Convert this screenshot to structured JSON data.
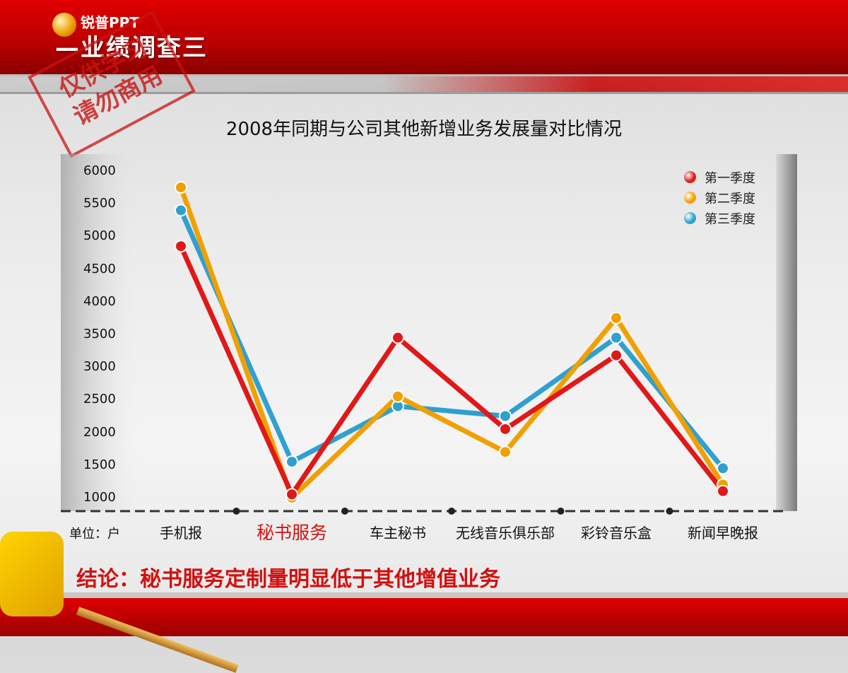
{
  "header": {
    "title": "—业绩调查三",
    "logo_text": "锐普PPT",
    "stamp_text": "仅供学习 请勿商用"
  },
  "colors": {
    "q1": "#e01818",
    "q2": "#f0a000",
    "q3": "#2fa0d0"
  },
  "chart_data": {
    "type": "line",
    "title": "2008年同期与公司其他新增业务发展量对比情况",
    "unit_label": "单位：户",
    "categories": [
      "手机报",
      "秘书服务",
      "车主秘书",
      "无线音乐俱乐部",
      "彩铃音乐盒",
      "新闻早晚报"
    ],
    "highlight_category": "秘书服务",
    "series": [
      {
        "name": "第一季度",
        "values": [
          4850,
          1050,
          3450,
          2050,
          3180,
          1100
        ]
      },
      {
        "name": "第二季度",
        "values": [
          5750,
          1000,
          2550,
          1700,
          3750,
          1200
        ]
      },
      {
        "name": "第三季度",
        "values": [
          5400,
          1550,
          2400,
          2250,
          3450,
          1450
        ]
      }
    ],
    "yticks": [
      1000,
      1500,
      2000,
      2500,
      3000,
      3500,
      4000,
      4500,
      5000,
      5500,
      6000
    ],
    "ylim": [
      1000,
      6000
    ],
    "legend_position": "top-right"
  },
  "conclusion": "结论：秘书服务定制量明显低于其他增值业务"
}
